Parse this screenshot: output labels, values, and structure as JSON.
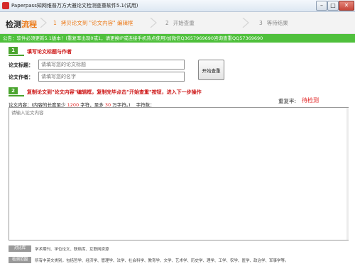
{
  "window": {
    "title": "Paperpass知网维普万方大雅论文检测查重软件5.1(试用)",
    "min_symbol": "–",
    "max_symbol": "□",
    "close_symbol": "✕"
  },
  "nav": {
    "title_part1": "检测",
    "title_part2": "流程",
    "steps": [
      {
        "num": "1",
        "label": "拷贝论文到 \"论文内容\" 编辑框"
      },
      {
        "num": "2",
        "label": "开始查重"
      },
      {
        "num": "3",
        "label": "等待结果"
      }
    ]
  },
  "notice": "公告：软件必须更新5.1版本！(重复率出现0或1，请更换IP或连接手机热点使用)加微信Q3657969690咨询查重QQ57369690",
  "step1": {
    "badge": "1",
    "instruction": "填写论文标题与作者",
    "title_label": "论文标题：",
    "title_placeholder": "请填写您的论文标题",
    "author_label": "论文作者：",
    "author_placeholder": "请填写您的名字",
    "check_button": "开始查重"
  },
  "step2": {
    "badge": "2",
    "instruction": "复制论文到\"论文内容\"编辑框，复制完毕点击\"开始查重\"按钮，进入下一步操作",
    "dup_label": "重复率:",
    "dup_value": "待检测",
    "content_label_1": "论文内容：(内容的长度至少",
    "min_chars": "1200",
    "content_label_2": "字符，至多",
    "max_chars": "30",
    "content_label_3": "万字符。)",
    "count_label": "字符数：",
    "content_placeholder": "请输入论文内容"
  },
  "footer": {
    "tag1": "对比库",
    "line1": "学术期刊、学位论文、联络库、互联网资源",
    "tag2": "检测范围",
    "line2": "所有中英文类别，包括哲学、经济学、管理学、法学、社会科学、教育学、文学、艺术学、历史学、理学、工学、农学、医学、政治学、军事学等。"
  },
  "colors": {
    "accent_orange": "#ec7a18",
    "notice_green": "#4fc03c",
    "badge_green": "#4aa52e",
    "alert_red": "#cc1111"
  }
}
